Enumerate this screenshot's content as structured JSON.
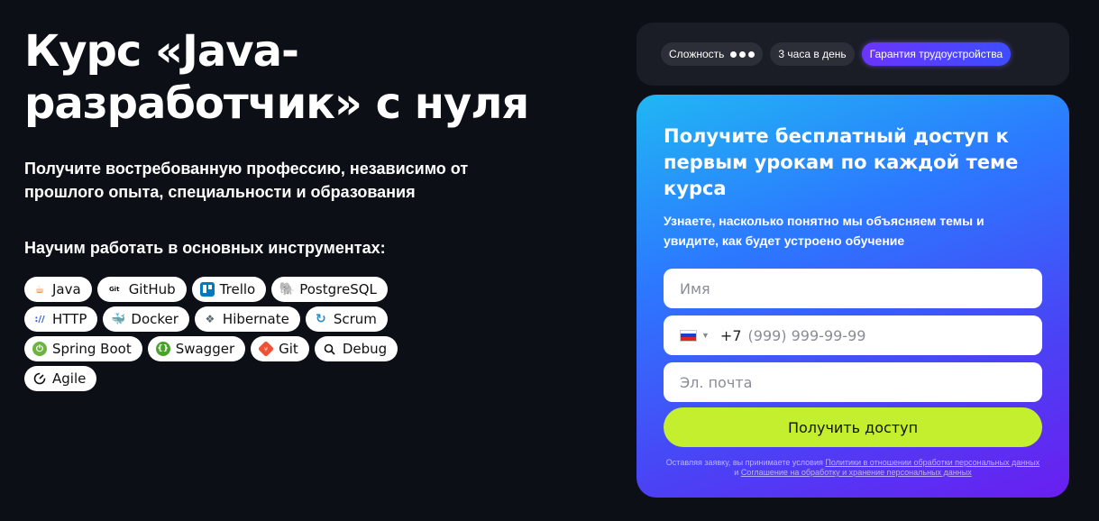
{
  "hero": {
    "title": "Курс «Java-разработчик» с нуля",
    "subtitle": "Получите востребованную профессию, независимо от прошлого опыта, специальности и образования",
    "tools_heading": "Научим работать в основных инструментах:"
  },
  "tools": [
    {
      "label": "Java",
      "icon": "java-icon"
    },
    {
      "label": "GitHub",
      "icon": "github-icon"
    },
    {
      "label": "Trello",
      "icon": "trello-icon"
    },
    {
      "label": "PostgreSQL",
      "icon": "postgresql-icon"
    },
    {
      "label": "HTTP",
      "icon": "http-icon"
    },
    {
      "label": "Docker",
      "icon": "docker-icon"
    },
    {
      "label": "Hibernate",
      "icon": "hibernate-icon"
    },
    {
      "label": "Scrum",
      "icon": "scrum-icon"
    },
    {
      "label": "Spring Boot",
      "icon": "spring-boot-icon"
    },
    {
      "label": "Swagger",
      "icon": "swagger-icon"
    },
    {
      "label": "Git",
      "icon": "git-icon"
    },
    {
      "label": "Debug",
      "icon": "search-icon"
    },
    {
      "label": "Agile",
      "icon": "agile-icon"
    }
  ],
  "tags": {
    "complexity": "Сложность",
    "complexity_level": 3,
    "hours": "3 часа в день",
    "guarantee": "Гарантия трудоустройства"
  },
  "form": {
    "title": "Получите бесплатный доступ к первым урокам по каждой теме курса",
    "subtitle": "Узнаете, насколько понятно мы объясняем темы и увидите, как будет устроено обучение",
    "name_placeholder": "Имя",
    "phone_prefix": "+7",
    "phone_placeholder": "(999) 999-99-99",
    "email_placeholder": "Эл. почта",
    "submit_label": "Получить доступ",
    "legal_prefix": "Оставляя заявку, вы принимаете условия ",
    "legal_link1": "Политики в отношении обработки персональных данных",
    "legal_mid": " и ",
    "legal_link2": "Соглашение на обработку и хранение персональных данных"
  },
  "colors": {
    "background": "#0d0f17",
    "accent_button": "#c4ef2e",
    "card_gradient_start": "#20b7f3",
    "card_gradient_end": "#6a1ef0"
  }
}
